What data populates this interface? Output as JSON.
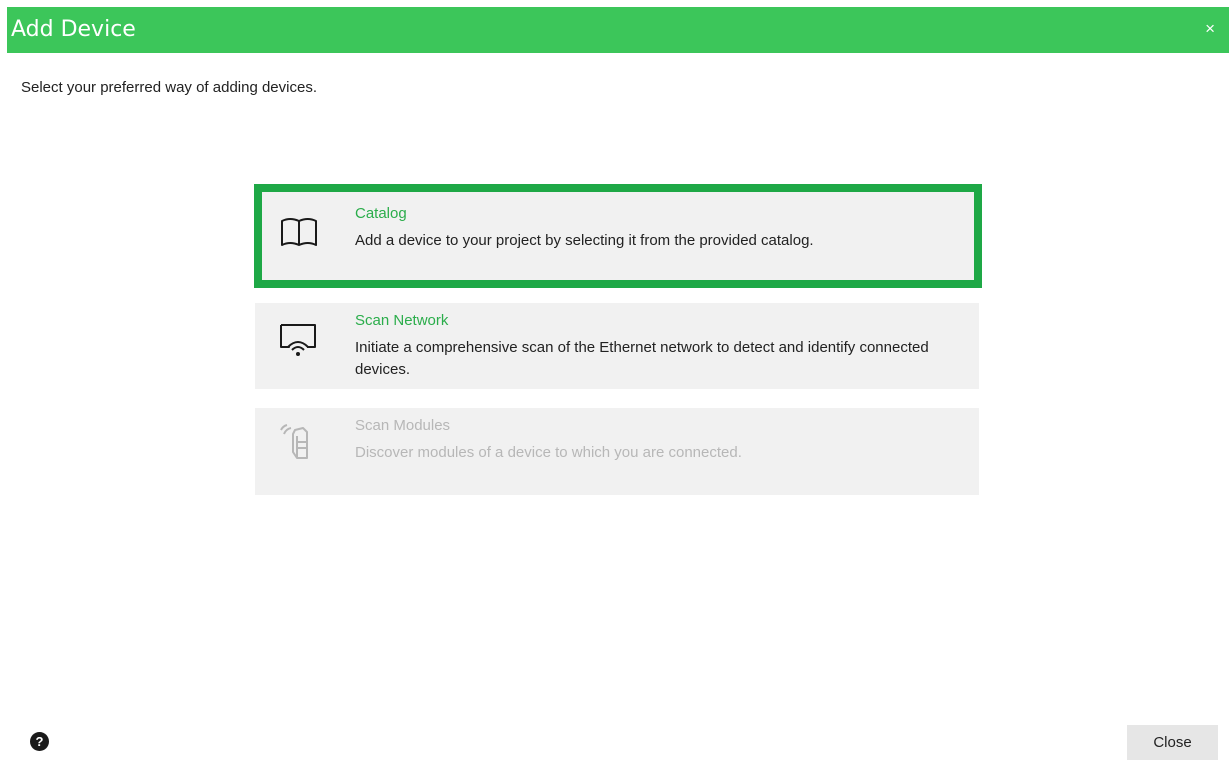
{
  "window": {
    "title": "Add Device",
    "close_glyph": "×"
  },
  "instruction": "Select your preferred way of adding devices.",
  "options": [
    {
      "title": "Catalog",
      "description": "Add a device to your project by selecting it from the provided catalog.",
      "icon": "book-icon",
      "state": "selected"
    },
    {
      "title": "Scan Network",
      "description": "Initiate a comprehensive scan of the Ethernet network to detect and identify connected devices.",
      "icon": "network-scan-icon",
      "state": "enabled"
    },
    {
      "title": "Scan Modules",
      "description": "Discover modules of a device to which you are connected.",
      "icon": "module-scan-icon",
      "state": "disabled"
    }
  ],
  "footer": {
    "help_glyph": "?",
    "close_label": "Close"
  },
  "colors": {
    "titlebar": "#3cc65a",
    "selection_border": "#1ea846",
    "option_title": "#2bad4b",
    "option_background": "#f1f1f1",
    "disabled_text": "#b7b7b7"
  }
}
